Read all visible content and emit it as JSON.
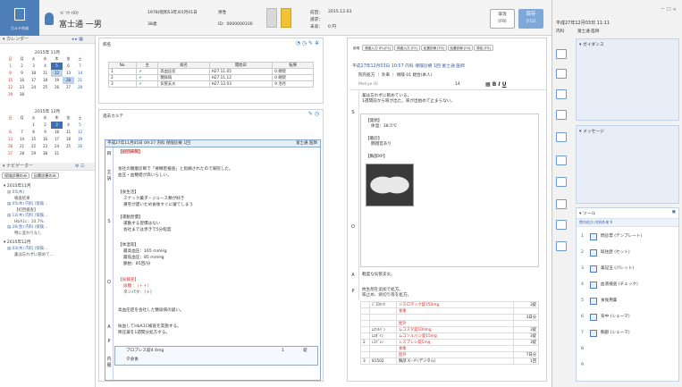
{
  "header": {
    "logo_label": "カルテ作成",
    "kana": "ﾌｼﾞﾂｳ ｲﾁﾛｳ",
    "name": "富士通 一男",
    "birth": "1978(昭和53年)01月01日",
    "sex": "男性",
    "age": "38歳",
    "id": "ID：0000000100",
    "prev_label": "前回：",
    "prev_value": "2015.12.03",
    "charge_label": "請求：",
    "unpaid_label": "未収：",
    "unpaid_value": "0 円",
    "cancel": "取消",
    "cancel_key": "[F9]",
    "save": "保存",
    "save_key": "[F12]"
  },
  "calendar": {
    "title": "カレンダー",
    "month1": "2015年 11月",
    "month2": "2015年 12月",
    "weekdays": [
      "日",
      "月",
      "火",
      "水",
      "木",
      "金",
      "土"
    ],
    "nov": [
      [
        "1",
        "2",
        "3",
        "4",
        "5",
        "6",
        "7"
      ],
      [
        "8",
        "9",
        "10",
        "11",
        "12",
        "13",
        "14"
      ],
      [
        "15",
        "16",
        "17",
        "18",
        "19",
        "20",
        "21"
      ],
      [
        "22",
        "23",
        "24",
        "25",
        "26",
        "27",
        "28"
      ],
      [
        "29",
        "30",
        "",
        "",
        "",
        "",
        ""
      ]
    ],
    "dec": [
      [
        "",
        "",
        "1",
        "2",
        "3",
        "4",
        "5"
      ],
      [
        "6",
        "7",
        "8",
        "9",
        "10",
        "11",
        "12"
      ],
      [
        "13",
        "14",
        "15",
        "16",
        "17",
        "18",
        "19"
      ],
      [
        "20",
        "21",
        "22",
        "23",
        "24",
        "25",
        "26"
      ],
      [
        "27",
        "28",
        "29",
        "30",
        "31",
        "",
        ""
      ]
    ]
  },
  "navigator": {
    "title": "ナビゲーター",
    "btn1": "保険診療のみ",
    "btn2": "自費診療のみ",
    "group1": "2015年11月",
    "items1": [
      "05(木)",
      "検査結果",
      "05(木) 内科 (保険…",
      "【初回検査】",
      "12(木) 内科 (保険…",
      "HbA1c：10.7%",
      "26(金) 内科 (保険…",
      "特に変わりなし"
    ],
    "group2": "2015年12月",
    "items2": [
      "03(木) 内科 (保険…",
      "薬は忘れずに飲めて…"
    ]
  },
  "disease": {
    "title": "病名",
    "cols": [
      "No.",
      "主",
      "病名",
      "開始日",
      "転帰"
    ],
    "rows": [
      [
        "1",
        "✔",
        "高血圧症",
        "H27.11.05",
        "0 継続"
      ],
      [
        "2",
        "✔",
        "糖尿病",
        "H27.11.12",
        "0 継続"
      ],
      [
        "3",
        "✔",
        "気管支炎",
        "H27.12.03",
        "9 治月"
      ]
    ]
  },
  "past": {
    "title": "過去カルテ",
    "header": "平成27年11月05日 09:27  内科  保険診療  1回",
    "doctor": "富士通 医師",
    "lines": [
      "【初回来院】",
      "会社の健康診断で「要精密検査」と指摘されたので来院した。",
      "血圧・血糖値が高いらしい。",
      "【食生活】",
      "スナック菓子・ジュース類が好き",
      "帰宅が遅いため食後すぐに寝てしまう",
      "【運動習慣】",
      "運動する習慣はない",
      "会社までは歩きで5分程度",
      "【体温等】",
      "最高血圧：165 mmHg",
      "最低血圧：85 mmHg",
      "脈拍：85回/分",
      "【尿検査】",
      "尿糖  ：（＋＋）",
      "タンパク：（＋）",
      "高血圧症を会社した糖尿病の疑い。",
      "採血してHbA1C検査を実施する。",
      "降圧薬を1週間分処方する。"
    ],
    "rx_name": "プロプレス錠4 4mg",
    "rx_qty": "1",
    "rx_unit": "錠",
    "rx_next": "タ食後"
  },
  "new": {
    "tabs": [
      "新規",
      "検査入力 (P)-[F1]",
      "検査入力 [F2]",
      "処置診療 [F3]",
      "処置診療 [F4]",
      "算定 [F5]"
    ],
    "header": "平成27年12月03日 10:57  内科  保険診療  1回  富士通  医師",
    "dept": "院内処方",
    "ward": "外来",
    "chk": "保険 01 組合(本人)",
    "font": "Meiryo UI",
    "size": "14",
    "s_lines": [
      "薬は忘れずに飲めている。",
      "1週間前から咳が出た。咳が出始めて止まらない。"
    ],
    "o_lines": [
      "【発熱】",
      "体温：38.5℃",
      "【聴診】",
      "肺雑音あり",
      "【胸部XP】"
    ],
    "a_line": "軽度な気管支炎。",
    "p_lines": [
      "抗生剤を追加で処方。",
      "咳止め、痰切り等を処方。"
    ]
  },
  "rx": [
    {
      "rp": "",
      "code": "ｼﾞｽﾛﾏｯｸ",
      "name": "ジスロマック錠250mg",
      "qty": "3錠",
      "red": true
    },
    {
      "rp": "",
      "code": "",
      "name": "食後",
      "qty": "",
      "red": true
    },
    {
      "rp": "",
      "code": "",
      "name": "",
      "qty": "3日分",
      "red": false
    },
    {
      "rp": "",
      "code": "",
      "name": "屋外",
      "qty": "",
      "red": true
    },
    {
      "rp": "",
      "code": "ﾑｺｿﾙﾊﾞﾝ",
      "name": "ムコスタ錠100mg",
      "qty": "3錠",
      "red": true
    },
    {
      "rp": "",
      "code": "ﾑｺﾀﾞｲﾝ",
      "name": "ムコソルバン錠15mg",
      "qty": "3錠",
      "red": true
    },
    {
      "rp": "2",
      "code": "ﾚｽﾌﾟﾚﾝ",
      "name": "レスプレン錠5mg",
      "qty": "3錠",
      "red": true
    },
    {
      "rp": "",
      "code": "",
      "name": "食後",
      "qty": "",
      "red": true
    },
    {
      "rp": "",
      "code": "",
      "name": "屋外",
      "qty": "7日分",
      "red": true
    },
    {
      "rp": "3",
      "code": "81502",
      "name": "胸部 X－P (デジタル)",
      "qty": "1回",
      "red": false
    }
  ],
  "sidebar": {
    "date": "平成27年12月03日  11:11",
    "dept": "内科",
    "user": "富士通 医師",
    "guidance": "ガイダンス",
    "message": "メッセージ",
    "tool_title": "ツール",
    "tool_sub": "院内処方  内科外来  9",
    "tools": [
      [
        "1",
        "問診票 (テンプレート)"
      ],
      [
        "2",
        "既往歴 (セット)"
      ],
      [
        "3",
        "薬記玉 (パレット)"
      ],
      [
        "4",
        "血液検査 (チェック)"
      ],
      [
        "5",
        "食後用薬"
      ],
      [
        "6",
        "背中 (シェーマ)"
      ],
      [
        "7",
        "胸部 (シェーマ)"
      ],
      [
        "8",
        ""
      ],
      [
        "9",
        ""
      ]
    ]
  }
}
